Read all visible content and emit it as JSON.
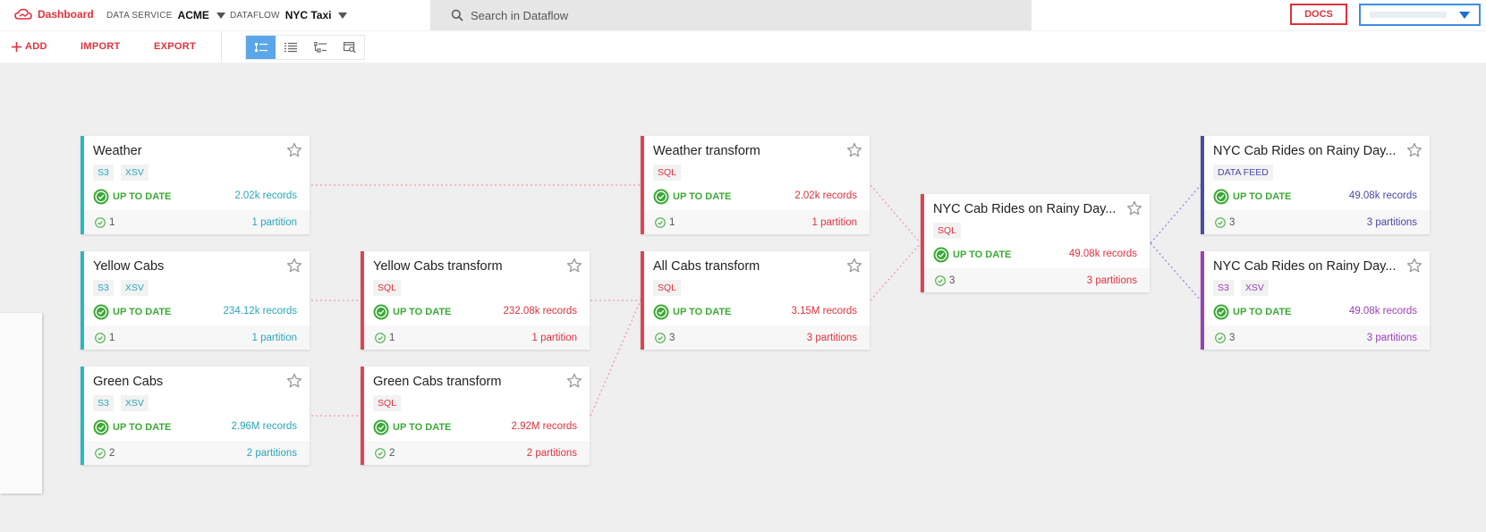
{
  "header": {
    "dashboard_label": "Dashboard",
    "data_service_label": "DATA SERVICE",
    "data_service_value": "ACME",
    "dataflow_label": "DATAFLOW",
    "dataflow_value": "NYC Taxi",
    "search_placeholder": "Search in Dataflow",
    "docs_label": "DOCS"
  },
  "toolbar": {
    "add_label": "ADD",
    "import_label": "IMPORT",
    "export_label": "EXPORT",
    "views": [
      "graph-view",
      "list-view",
      "tree-view",
      "preview-view"
    ],
    "active_view": "graph-view"
  },
  "colors": {
    "brand": "#e0323d",
    "teal": "#2ab7c2",
    "indigo": "#4b4ba8",
    "purple": "#9c3fb8",
    "status_green": "#3aa935",
    "active_view": "#5aa6e8"
  },
  "nodes": {
    "weather": {
      "title": "Weather",
      "tags": [
        "S3",
        "XSV"
      ],
      "status": "UP TO DATE",
      "records": "2.02k records",
      "count": "1",
      "partitions": "1 partition"
    },
    "yellow_cabs": {
      "title": "Yellow Cabs",
      "tags": [
        "S3",
        "XSV"
      ],
      "status": "UP TO DATE",
      "records": "234.12k records",
      "count": "1",
      "partitions": "1 partition"
    },
    "green_cabs": {
      "title": "Green Cabs",
      "tags": [
        "S3",
        "XSV"
      ],
      "status": "UP TO DATE",
      "records": "2.96M records",
      "count": "2",
      "partitions": "2 partitions"
    },
    "yellow_transform": {
      "title": "Yellow Cabs transform",
      "tags": [
        "SQL"
      ],
      "status": "UP TO DATE",
      "records": "232.08k records",
      "count": "1",
      "partitions": "1 partition"
    },
    "green_transform": {
      "title": "Green Cabs transform",
      "tags": [
        "SQL"
      ],
      "status": "UP TO DATE",
      "records": "2.92M records",
      "count": "2",
      "partitions": "2 partitions"
    },
    "weather_transform": {
      "title": "Weather transform",
      "tags": [
        "SQL"
      ],
      "status": "UP TO DATE",
      "records": "2.02k records",
      "count": "1",
      "partitions": "1 partition"
    },
    "all_cabs_transform": {
      "title": "All Cabs transform",
      "tags": [
        "SQL"
      ],
      "status": "UP TO DATE",
      "records": "3.15M records",
      "count": "3",
      "partitions": "3 partitions"
    },
    "rainy_join": {
      "title": "NYC Cab Rides on Rainy Day...",
      "tags": [
        "SQL"
      ],
      "status": "UP TO DATE",
      "records": "49.08k records",
      "count": "3",
      "partitions": "3 partitions"
    },
    "rainy_feed": {
      "title": "NYC Cab Rides on Rainy Day...",
      "tags": [
        "DATA FEED"
      ],
      "status": "UP TO DATE",
      "records": "49.08k records",
      "count": "3",
      "partitions": "3 partitions"
    },
    "rainy_s3": {
      "title": "NYC Cab Rides on Rainy Day...",
      "tags": [
        "S3",
        "XSV"
      ],
      "status": "UP TO DATE",
      "records": "49.08k records",
      "count": "3",
      "partitions": "3 partitions"
    }
  }
}
